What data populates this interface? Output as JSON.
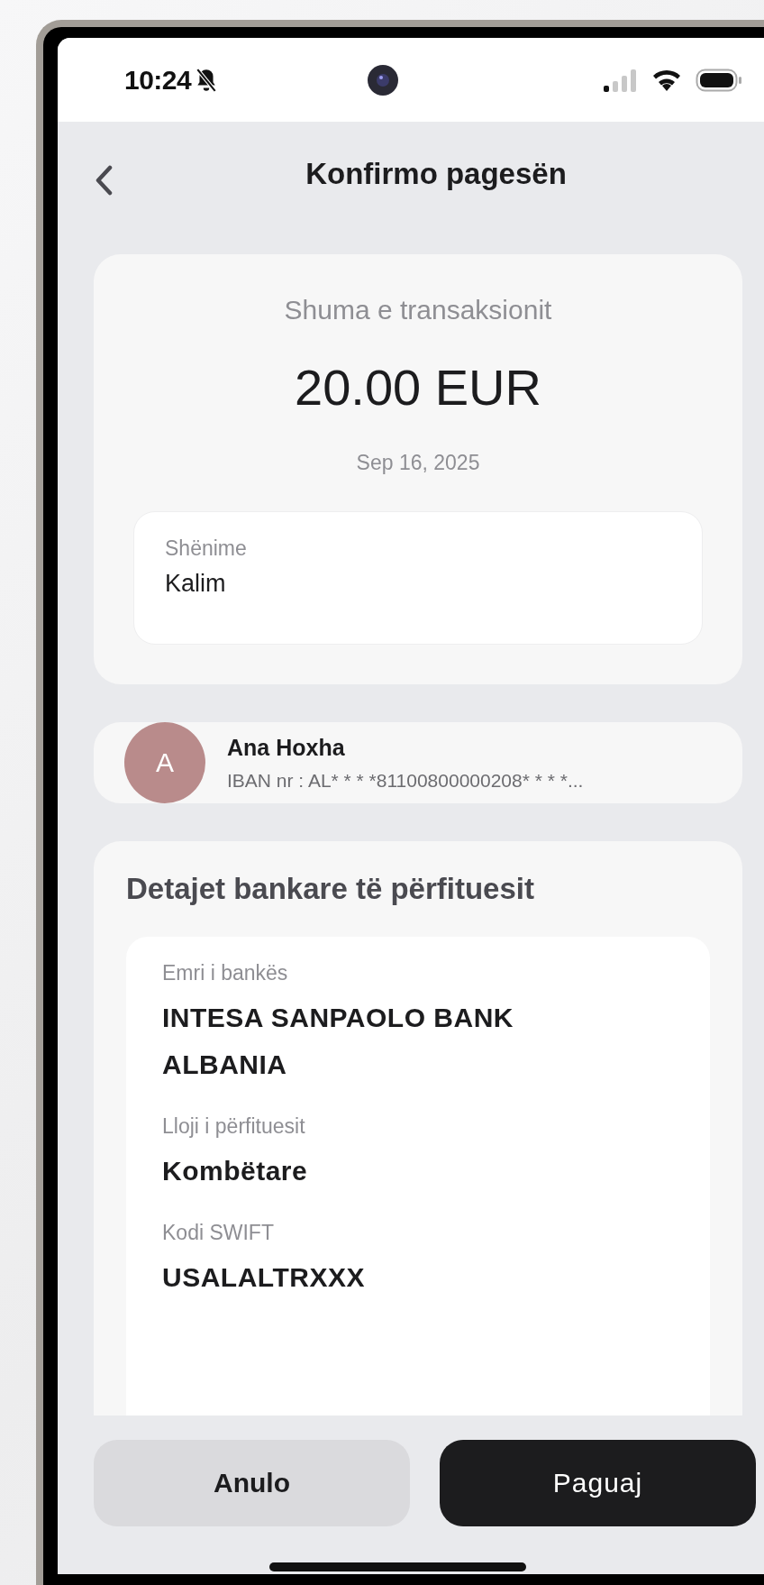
{
  "status_bar": {
    "time": "10:24"
  },
  "header": {
    "title": "Konfirmo pagesën"
  },
  "amount_card": {
    "label": "Shuma e transaksionit",
    "amount": "20.00 EUR",
    "date": "Sep 16, 2025",
    "note": {
      "label": "Shënime",
      "value": "Kalim"
    }
  },
  "recipient": {
    "initial": "A",
    "name": "Ana Hoxha",
    "iban_label": "IBAN nr :",
    "iban": "AL* * * *81100800000208* * * *..."
  },
  "bank_details": {
    "title": "Detajet bankare të përfituesit",
    "fields": [
      {
        "label": "Emri i bankës",
        "value": "INTESA SANPAOLO BANK ALBANIA"
      },
      {
        "label": "Lloji i përfituesit",
        "value": "Kombëtare"
      },
      {
        "label": "Kodi SWIFT",
        "value": "USALALTRXXX"
      }
    ]
  },
  "buttons": [
    {
      "label": "Anulo",
      "kind": "secondary"
    },
    {
      "label": "Paguaj",
      "kind": "primary"
    }
  ]
}
